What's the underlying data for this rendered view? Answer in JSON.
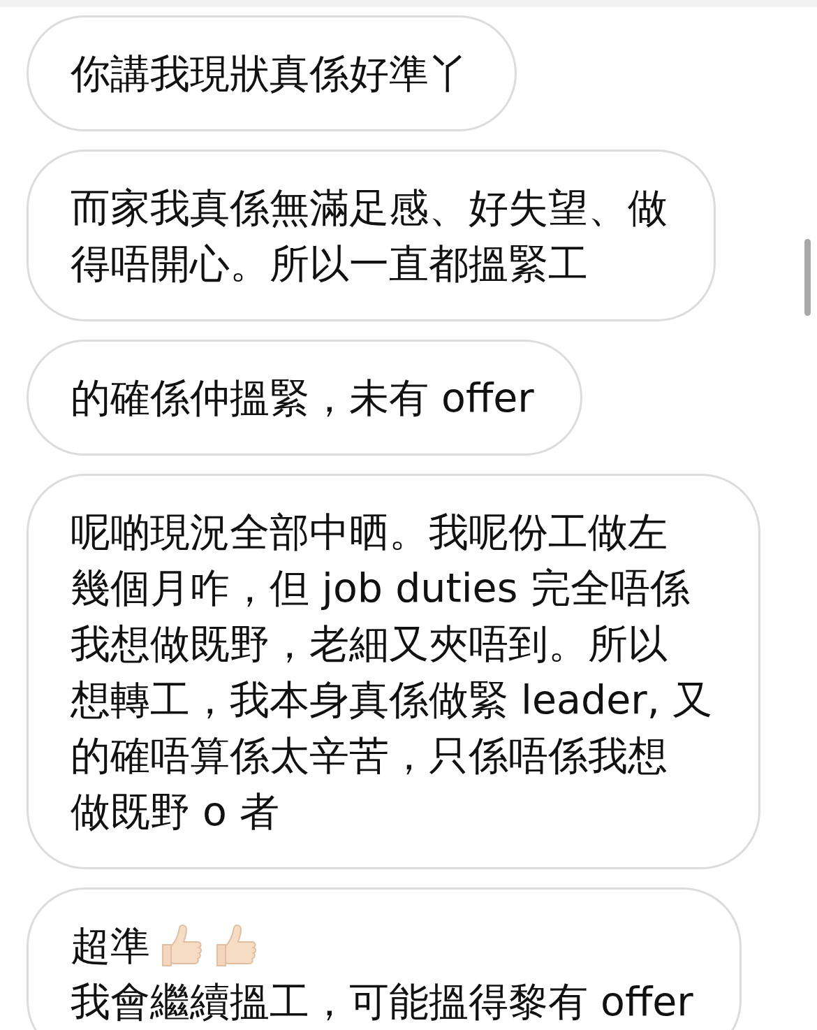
{
  "messages": [
    {
      "lines": [
        {
          "text": "你講我現狀真係好準丫"
        }
      ]
    },
    {
      "lines": [
        {
          "text": "而家我真係無滿足感、好失望、做"
        },
        {
          "text": "得唔開心。所以一直都搵緊工"
        }
      ]
    },
    {
      "lines": [
        {
          "text": "的確係仲搵緊，未有 offer"
        }
      ]
    },
    {
      "lines": [
        {
          "text": "呢啲現況全部中晒。我呢份工做左"
        },
        {
          "text": "幾個月咋，但 job duties 完全唔係"
        },
        {
          "text": "我想做既野，老細又夾唔到。所以"
        },
        {
          "text": "想轉工，我本身真係做緊 leader, 又"
        },
        {
          "text": "的確唔算係太辛苦，只係唔係我想"
        },
        {
          "text": "做既野 o 者"
        }
      ]
    },
    {
      "lines": [
        {
          "text": "超準",
          "icons": [
            {
              "kind": "thumbs-up"
            },
            {
              "kind": "thumbs-up"
            }
          ]
        },
        {
          "text": "我會繼續搵工，可能搵得黎有 offer"
        }
      ]
    }
  ]
}
